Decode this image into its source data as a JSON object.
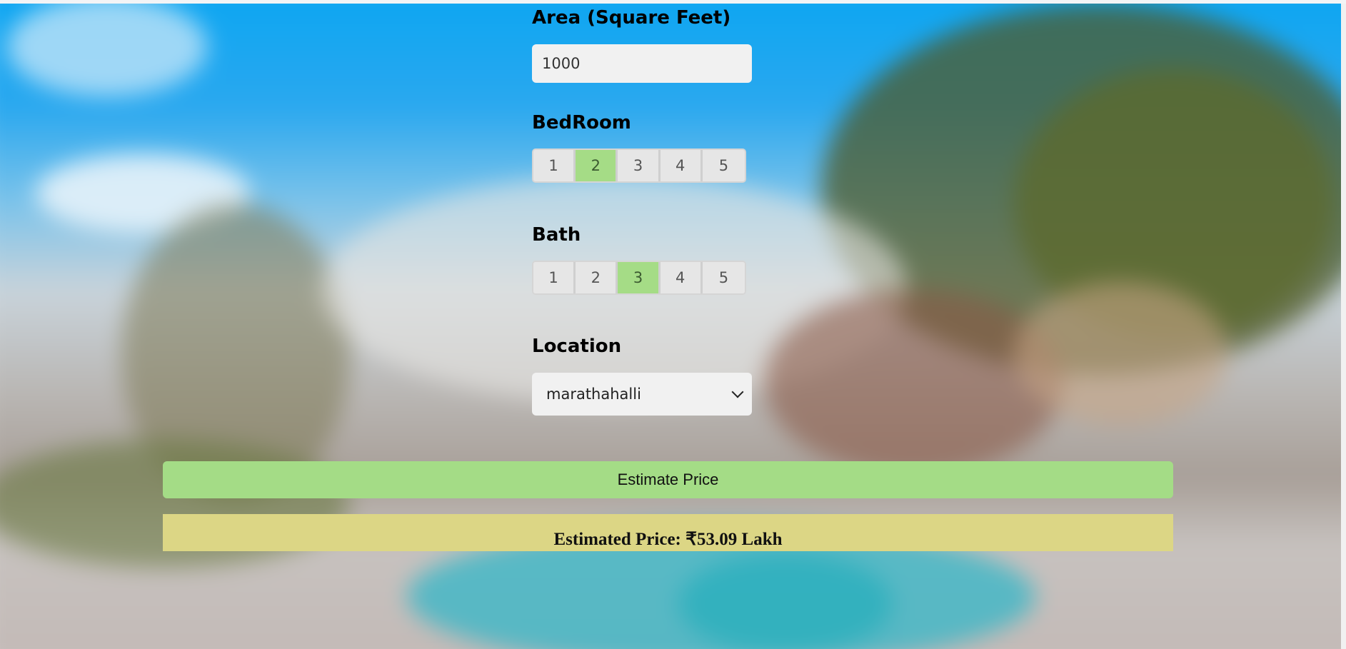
{
  "form": {
    "area_label": "Area (Square Feet)",
    "area_value": "1000",
    "bedroom_label": "BedRoom",
    "bedroom_options": [
      "1",
      "2",
      "3",
      "4",
      "5"
    ],
    "bedroom_selected": "2",
    "bath_label": "Bath",
    "bath_options": [
      "1",
      "2",
      "3",
      "4",
      "5"
    ],
    "bath_selected": "3",
    "location_label": "Location",
    "location_value": "marathahalli"
  },
  "actions": {
    "estimate_label": "Estimate Price"
  },
  "result": {
    "text": "Estimated Price: ₹53.09 Lakh"
  },
  "colors": {
    "selected": "#a5dc86",
    "button": "#a4dc86",
    "result_bg": "#dcd685"
  }
}
